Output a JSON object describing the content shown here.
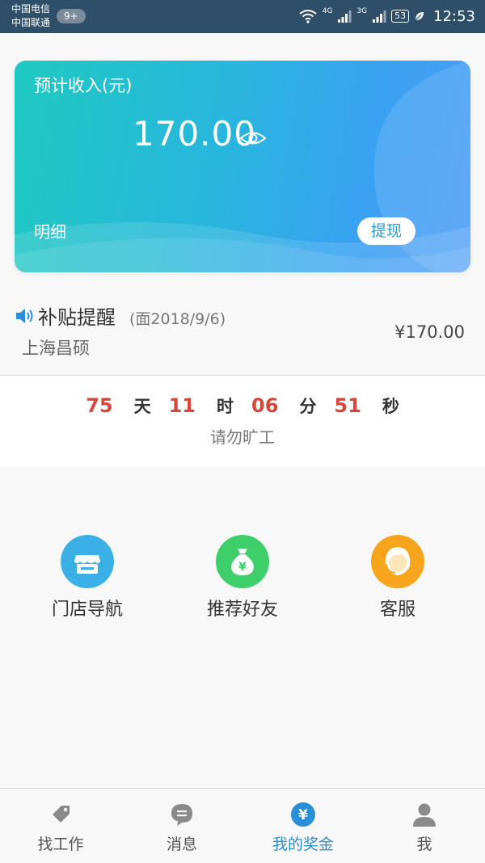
{
  "status_bar": {
    "carrier1": "中国电信",
    "carrier2": "中国联通",
    "notif_badge": "9+",
    "net1": "4G",
    "net2": "3G",
    "battery": "53",
    "time": "12:53"
  },
  "income_card": {
    "title": "预计收入(元)",
    "amount": "170.00",
    "detail_label": "明细",
    "withdraw_label": "提现"
  },
  "subsidy": {
    "title": "补贴提醒",
    "date": "(面2018/9/6)",
    "company": "上海昌硕",
    "amount": "¥170.00"
  },
  "countdown": {
    "days": "75",
    "days_unit": "天",
    "hours": "11",
    "hours_unit": "时",
    "minutes": "06",
    "minutes_unit": "分",
    "seconds": "51",
    "seconds_unit": "秒",
    "note": "请勿旷工"
  },
  "shortcuts": [
    {
      "label": "门店导航",
      "icon": "store-icon",
      "color": "#3ab0e6"
    },
    {
      "label": "推荐好友",
      "icon": "money-bag-icon",
      "color": "#3fcf6a"
    },
    {
      "label": "客服",
      "icon": "customer-service-icon",
      "color": "#f7a51c"
    }
  ],
  "bottom_nav": [
    {
      "label": "找工作",
      "icon": "tag-icon",
      "active": false
    },
    {
      "label": "消息",
      "icon": "message-icon",
      "active": false
    },
    {
      "label": "我的奖金",
      "icon": "yen-icon",
      "active": true
    },
    {
      "label": "我",
      "icon": "profile-icon",
      "active": false
    }
  ],
  "colors": {
    "accent": "#2a8fd6",
    "countdown_number": "#d8463a",
    "status_bar": "#2f4f68"
  }
}
